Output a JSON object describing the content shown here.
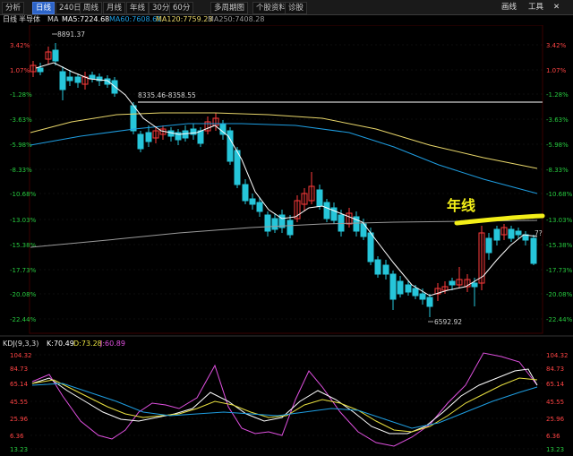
{
  "toolbar": {
    "tabs": [
      "分析",
      "日线",
      "240日",
      "周线",
      "月线",
      "年线",
      "30分",
      "60分",
      "多周期图",
      "个股资料",
      "诊股"
    ],
    "active_tab": "日线",
    "right_tools": [
      "画线",
      "工具"
    ]
  },
  "infobar": {
    "period": "日线",
    "instrument": "半导体",
    "ma_label": "MA",
    "ma5": "MA5:7224.68",
    "ma60": "MA60:7608.61",
    "ma120": "MA120:7759.23",
    "ma250": "MA250:7408.28"
  },
  "price_axis": [
    "3.42%",
    "1.07%",
    "-1.28%",
    "-3.63%",
    "-5.98%",
    "-8.33%",
    "-10.68%",
    "-13.03%",
    "-15.38%",
    "-17.73%",
    "-20.08%",
    "-22.44%"
  ],
  "annotations": {
    "high": "8891.37",
    "range": "8335.46-8358.55",
    "low": "6592.92",
    "last": "7?",
    "handwritten_note": "年线"
  },
  "kdj": {
    "label": "KDJ(9,3,3)",
    "k": "K:70.49",
    "d": "D:73.28",
    "j": "J:60.89",
    "axis": [
      "104.32",
      "84.73",
      "65.14",
      "45.55",
      "25.96",
      "6.36",
      "13.23"
    ]
  },
  "colors": {
    "up": "#ff3b3b",
    "down": "#26c6da",
    "ma5": "#ffffff",
    "ma60": "#1e9de0",
    "ma120": "#e8d66a",
    "ma250": "#9a9a9a",
    "k": "#ffffff",
    "d": "#e8e040",
    "j": "#e050e0",
    "highlight": "#f3ef18"
  }
}
